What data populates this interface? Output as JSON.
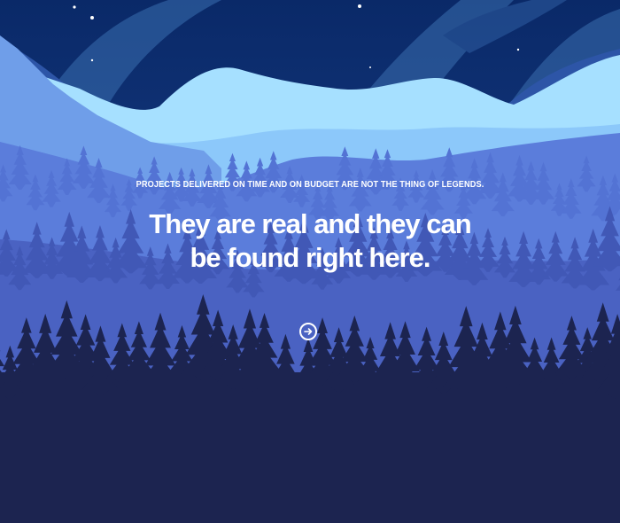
{
  "hero": {
    "eyebrow": "PROJECTS DELIVERED ON TIME AND ON BUDGET ARE NOT THE THING OF LEGENDS.",
    "headline": "They are real and they can be found right here.",
    "cta_icon": "arrow-right-circle-icon"
  },
  "colors": {
    "sky_top": "#0d2f72",
    "sky_bottom": "#1f4f9c",
    "aurora": "#3f78b6",
    "far_mountain": "#9fdcff",
    "mid_layer": "#7cb4f2",
    "forest_mid": "#5b7fda",
    "forest_near": "#4256b4",
    "forest_front": "#1c2450",
    "text": "#ffffff"
  }
}
